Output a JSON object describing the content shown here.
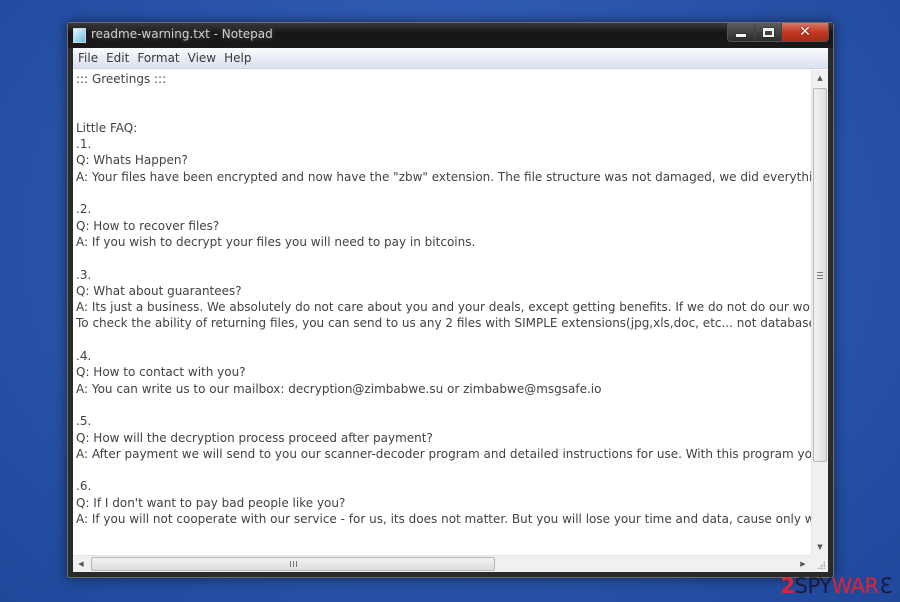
{
  "window": {
    "title": "readme-warning.txt - Notepad",
    "icon": "notepad-icon",
    "controls": {
      "minimize": "minimize-icon",
      "maximize": "maximize-icon",
      "close": "✕"
    }
  },
  "menubar": {
    "items": [
      "File",
      "Edit",
      "Format",
      "View",
      "Help"
    ]
  },
  "document": {
    "lines": [
      "::: Greetings :::",
      "",
      "",
      "Little FAQ:",
      ".1.",
      "Q: Whats Happen?",
      "A: Your files have been encrypted and now have the \"zbw\" extension. The file structure was not damaged, we did everything p",
      "",
      ".2.",
      "Q: How to recover files?",
      "A: If you wish to decrypt your files you will need to pay in bitcoins.",
      "",
      ".3.",
      "Q: What about guarantees?",
      "A: Its just a business. We absolutely do not care about you and your deals, except getting benefits. If we do not do our work ar",
      "To check the ability of returning files, you can send to us any 2 files with SIMPLE extensions(jpg,xls,doc, etc... not databases!)",
      "",
      ".4.",
      "Q: How to contact with you?",
      "A: You can write us to our mailbox: decryption@zimbabwe.su or zimbabwe@msgsafe.io",
      "",
      ".5.",
      "Q: How will the decryption process proceed after payment?",
      "A: After payment we will send to you our scanner-decoder program and detailed instructions for use. With this program you wil",
      "",
      ".6.",
      "Q: If I don't want to pay bad people like you?",
      "A: If you will not cooperate with our service - for us, its does not matter. But you will lose your time and data, cause only we ha"
    ]
  },
  "scrollbars": {
    "vertical_up": "▲",
    "vertical_down": "▼",
    "horizontal_left": "◀",
    "horizontal_right": "▶"
  },
  "watermark": {
    "digit": "2",
    "spy": "SPY",
    "ware": "WAR",
    "arrow": "Ɛ"
  }
}
